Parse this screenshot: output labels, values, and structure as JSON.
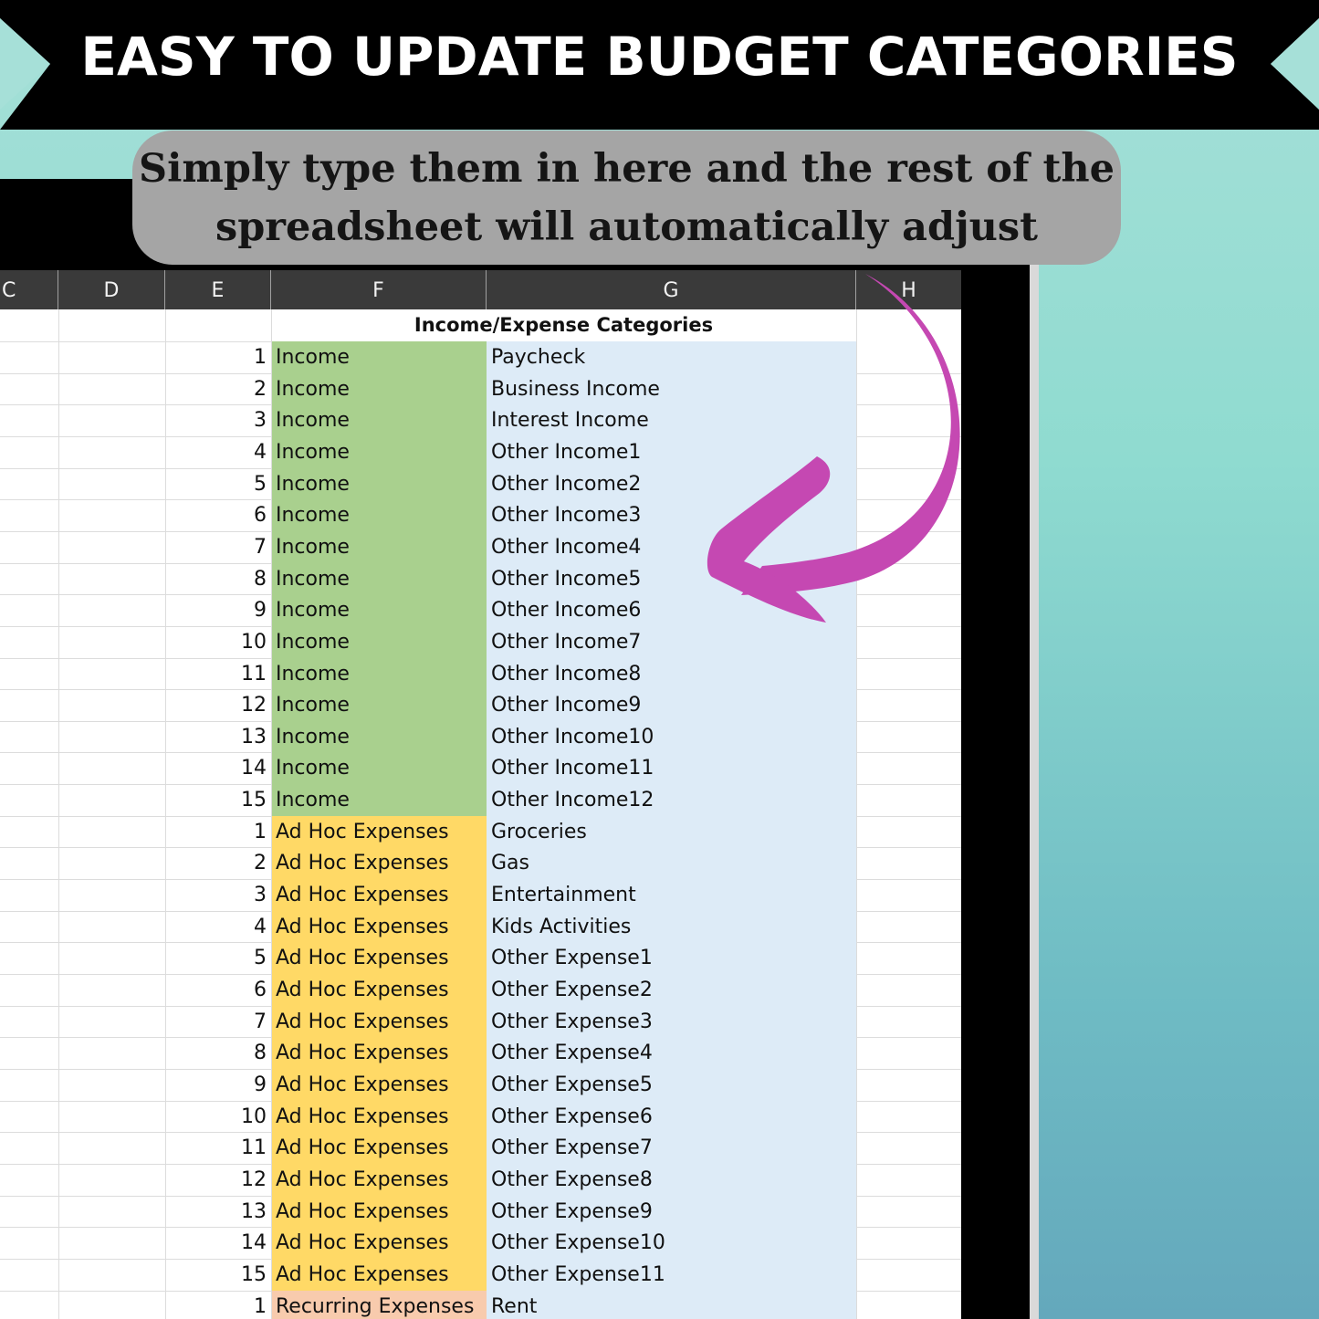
{
  "banner": {
    "title": "EASY TO UPDATE BUDGET CATEGORIES",
    "background_color": "#000000"
  },
  "callout": {
    "line1": "Simply type them in here and the rest of the",
    "line2": "spreadsheet will automatically adjust",
    "background_color": "#a5a5a5"
  },
  "arrow": {
    "icon": "curved-arrow-icon",
    "color": "#c548b2"
  },
  "sheet": {
    "columns": [
      "C",
      "D",
      "E",
      "F",
      "G",
      "H"
    ],
    "table_title": "Income/Expense Categories",
    "group_colors": {
      "Income": "#a9d08e",
      "Ad Hoc Expenses": "#ffd966",
      "Recurring Expenses": "#f8cbad",
      "subcategory": "#ddebf7"
    },
    "rows": [
      {
        "num": "1",
        "category": "Income",
        "subcategory": "Paycheck"
      },
      {
        "num": "2",
        "category": "Income",
        "subcategory": "Business Income"
      },
      {
        "num": "3",
        "category": "Income",
        "subcategory": "Interest Income"
      },
      {
        "num": "4",
        "category": "Income",
        "subcategory": "Other Income1"
      },
      {
        "num": "5",
        "category": "Income",
        "subcategory": "Other Income2"
      },
      {
        "num": "6",
        "category": "Income",
        "subcategory": "Other Income3"
      },
      {
        "num": "7",
        "category": "Income",
        "subcategory": "Other Income4"
      },
      {
        "num": "8",
        "category": "Income",
        "subcategory": "Other Income5"
      },
      {
        "num": "9",
        "category": "Income",
        "subcategory": "Other Income6"
      },
      {
        "num": "10",
        "category": "Income",
        "subcategory": "Other Income7"
      },
      {
        "num": "11",
        "category": "Income",
        "subcategory": "Other Income8"
      },
      {
        "num": "12",
        "category": "Income",
        "subcategory": "Other Income9"
      },
      {
        "num": "13",
        "category": "Income",
        "subcategory": "Other Income10"
      },
      {
        "num": "14",
        "category": "Income",
        "subcategory": "Other Income11"
      },
      {
        "num": "15",
        "category": "Income",
        "subcategory": "Other Income12"
      },
      {
        "num": "1",
        "category": "Ad Hoc Expenses",
        "subcategory": "Groceries"
      },
      {
        "num": "2",
        "category": "Ad Hoc Expenses",
        "subcategory": "Gas"
      },
      {
        "num": "3",
        "category": "Ad Hoc Expenses",
        "subcategory": "Entertainment"
      },
      {
        "num": "4",
        "category": "Ad Hoc Expenses",
        "subcategory": "Kids Activities"
      },
      {
        "num": "5",
        "category": "Ad Hoc Expenses",
        "subcategory": "Other Expense1"
      },
      {
        "num": "6",
        "category": "Ad Hoc Expenses",
        "subcategory": "Other Expense2"
      },
      {
        "num": "7",
        "category": "Ad Hoc Expenses",
        "subcategory": "Other Expense3"
      },
      {
        "num": "8",
        "category": "Ad Hoc Expenses",
        "subcategory": "Other Expense4"
      },
      {
        "num": "9",
        "category": "Ad Hoc Expenses",
        "subcategory": "Other Expense5"
      },
      {
        "num": "10",
        "category": "Ad Hoc Expenses",
        "subcategory": "Other Expense6"
      },
      {
        "num": "11",
        "category": "Ad Hoc Expenses",
        "subcategory": "Other Expense7"
      },
      {
        "num": "12",
        "category": "Ad Hoc Expenses",
        "subcategory": "Other Expense8"
      },
      {
        "num": "13",
        "category": "Ad Hoc Expenses",
        "subcategory": "Other Expense9"
      },
      {
        "num": "14",
        "category": "Ad Hoc Expenses",
        "subcategory": "Other Expense10"
      },
      {
        "num": "15",
        "category": "Ad Hoc Expenses",
        "subcategory": "Other Expense11"
      },
      {
        "num": "1",
        "category": "Recurring Expenses",
        "subcategory": "Rent"
      }
    ]
  }
}
